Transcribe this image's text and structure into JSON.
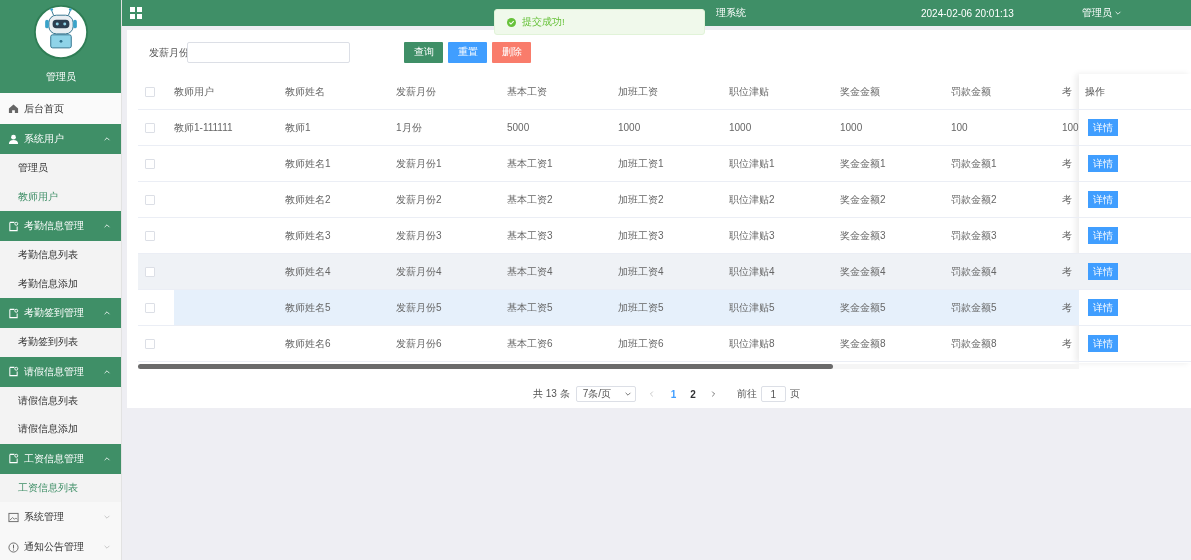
{
  "sidebar": {
    "user_name": "管理员",
    "menu": [
      {
        "kind": "item",
        "label": "后台首页"
      },
      {
        "kind": "group",
        "label": "系统用户",
        "expanded": true,
        "children": [
          {
            "label": "管理员",
            "selected": false
          },
          {
            "label": "教师用户",
            "selected": true
          }
        ]
      },
      {
        "kind": "group",
        "label": "考勤信息管理",
        "expanded": true,
        "children": [
          {
            "label": "考勤信息列表",
            "selected": false
          },
          {
            "label": "考勤信息添加",
            "selected": false
          }
        ]
      },
      {
        "kind": "group",
        "label": "考勤签到管理",
        "expanded": true,
        "children": [
          {
            "label": "考勤签到列表",
            "selected": false
          }
        ]
      },
      {
        "kind": "group",
        "label": "请假信息管理",
        "expanded": true,
        "children": [
          {
            "label": "请假信息列表",
            "selected": false
          },
          {
            "label": "请假信息添加",
            "selected": false
          }
        ]
      },
      {
        "kind": "group",
        "label": "工资信息管理",
        "expanded": true,
        "children": [
          {
            "label": "工资信息列表",
            "selected": true
          }
        ]
      },
      {
        "kind": "group",
        "label": "系统管理",
        "expanded": false
      },
      {
        "kind": "group",
        "label": "通知公告管理",
        "expanded": false
      }
    ]
  },
  "header": {
    "title": "理系统",
    "datetime": "2024-02-06 20:01:13",
    "user_menu": "管理员"
  },
  "toast": {
    "message": "提交成功!"
  },
  "search": {
    "label": "发薪月份"
  },
  "buttons": [
    {
      "label": "查询",
      "kind": "primary"
    },
    {
      "label": "重置",
      "kind": "info"
    },
    {
      "label": "删除",
      "kind": "danger"
    }
  ],
  "table": {
    "select_all_checked": false,
    "columns": [
      "教师用户",
      "教师姓名",
      "发薪月份",
      "基本工资",
      "加班工资",
      "职位津贴",
      "奖金金额",
      "罚款金额",
      "考"
    ],
    "action_column": "操作",
    "rows": [
      {
        "checked": false,
        "striped": false,
        "hovered": false,
        "cells": [
          "教师1-111111",
          "教师1",
          "1月份",
          "5000",
          "1000",
          "1000",
          "1000",
          "100",
          "100"
        ],
        "action": "详情"
      },
      {
        "checked": false,
        "striped": false,
        "hovered": false,
        "cells": [
          null,
          "教师姓名1",
          "发薪月份1",
          "基本工资1",
          "加班工资1",
          "职位津贴1",
          "奖金金额1",
          "罚款金额1",
          "考"
        ],
        "action": "详情"
      },
      {
        "checked": false,
        "striped": false,
        "hovered": false,
        "cells": [
          null,
          "教师姓名2",
          "发薪月份2",
          "基本工资2",
          "加班工资2",
          "职位津贴2",
          "奖金金额2",
          "罚款金额2",
          "考"
        ],
        "action": "详情"
      },
      {
        "checked": false,
        "striped": false,
        "hovered": false,
        "cells": [
          null,
          "教师姓名3",
          "发薪月份3",
          "基本工资3",
          "加班工资3",
          "职位津贴3",
          "奖金金额3",
          "罚款金额3",
          "考"
        ],
        "action": "详情"
      },
      {
        "checked": false,
        "striped": true,
        "hovered": false,
        "cells": [
          null,
          "教师姓名4",
          "发薪月份4",
          "基本工资4",
          "加班工资4",
          "职位津贴4",
          "奖金金额4",
          "罚款金额4",
          "考"
        ],
        "action": "详情"
      },
      {
        "checked": false,
        "striped": false,
        "hovered": true,
        "cells": [
          null,
          "教师姓名5",
          "发薪月份5",
          "基本工资5",
          "加班工资5",
          "职位津贴5",
          "奖金金额5",
          "罚款金额5",
          "考"
        ],
        "action": "详情"
      },
      {
        "checked": false,
        "striped": false,
        "hovered": false,
        "cells": [
          null,
          "教师姓名6",
          "发薪月份6",
          "基本工资6",
          "加班工资6",
          "职位津贴8",
          "奖金金额8",
          "罚款金额8",
          "考"
        ],
        "action": "详情"
      }
    ]
  },
  "pagination": {
    "total": "共 13 条",
    "page_size": "7条/页",
    "pages": [
      {
        "label": "1",
        "selected": true
      },
      {
        "label": "2",
        "selected": false
      }
    ],
    "goto_label": "前往",
    "goto_value": "1",
    "goto_suffix": "页"
  }
}
